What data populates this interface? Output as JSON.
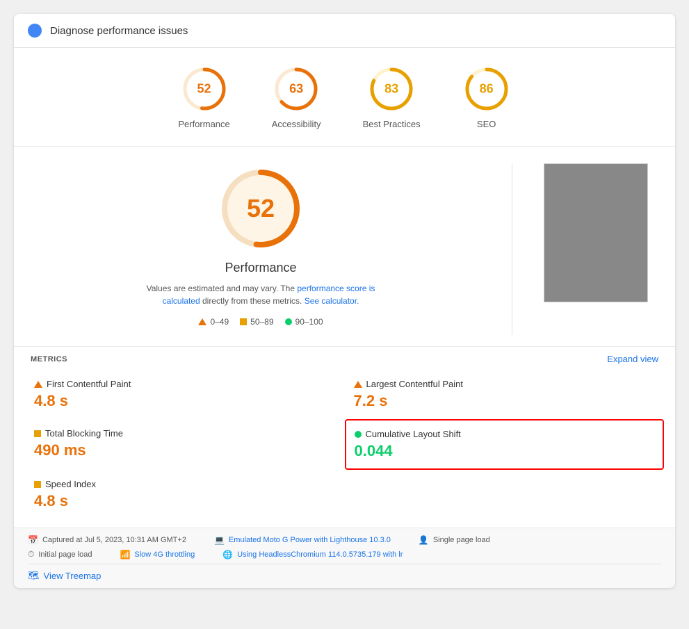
{
  "header": {
    "title": "Diagnose performance issues"
  },
  "scores": [
    {
      "id": "performance",
      "value": 52,
      "label": "Performance",
      "color": "#e8710a",
      "bg": "#fff3e0"
    },
    {
      "id": "accessibility",
      "value": 63,
      "label": "Accessibility",
      "color": "#e8710a",
      "bg": "#fff3e0"
    },
    {
      "id": "best-practices",
      "value": 83,
      "label": "Best Practices",
      "color": "#e8a000",
      "bg": "#fff8e1"
    },
    {
      "id": "seo",
      "value": 86,
      "label": "SEO",
      "color": "#e8a000",
      "bg": "#fff8e1"
    }
  ],
  "main": {
    "big_score": 52,
    "big_score_color": "#e8710a",
    "perf_label": "Performance",
    "desc_line1": "Values are estimated and may vary. The ",
    "desc_link1": "performance score is calculated",
    "desc_line2": " directly from these metrics. ",
    "desc_link2": "See calculator.",
    "legend": {
      "range1": "0–49",
      "range2": "50–89",
      "range3": "90–100"
    }
  },
  "metrics": {
    "header": "METRICS",
    "expand": "Expand view",
    "items": [
      {
        "id": "fcp",
        "name": "First Contentful Paint",
        "value": "4.8 s",
        "indicator": "triangle",
        "value_class": "value-red",
        "highlighted": false
      },
      {
        "id": "lcp",
        "name": "Largest Contentful Paint",
        "value": "7.2 s",
        "indicator": "triangle",
        "value_class": "value-red",
        "highlighted": false
      },
      {
        "id": "tbt",
        "name": "Total Blocking Time",
        "value": "490 ms",
        "indicator": "square",
        "value_class": "value-red",
        "highlighted": false
      },
      {
        "id": "cls",
        "name": "Cumulative Layout Shift",
        "value": "0.044",
        "indicator": "circle-green",
        "value_class": "value-green",
        "highlighted": true
      },
      {
        "id": "si",
        "name": "Speed Index",
        "value": "4.8 s",
        "indicator": "square",
        "value_class": "value-red",
        "highlighted": false
      }
    ]
  },
  "footer": {
    "row1": [
      {
        "icon": "📅",
        "text": "Captured at Jul 5, 2023, 10:31 AM GMT+2"
      },
      {
        "icon": "💻",
        "text": "Emulated Moto G Power with Lighthouse 10.3.0",
        "is_link": true
      },
      {
        "icon": "👤",
        "text": "Single page load"
      }
    ],
    "row2": [
      {
        "icon": "⏱",
        "text": "Initial page load"
      },
      {
        "icon": "📶",
        "text": "Slow 4G throttling",
        "is_link": true
      },
      {
        "icon": "🌐",
        "text": "Using HeadlessChromium 114.0.5735.179 with lr",
        "is_link": true
      }
    ],
    "treemap_label": "View Treemap"
  }
}
